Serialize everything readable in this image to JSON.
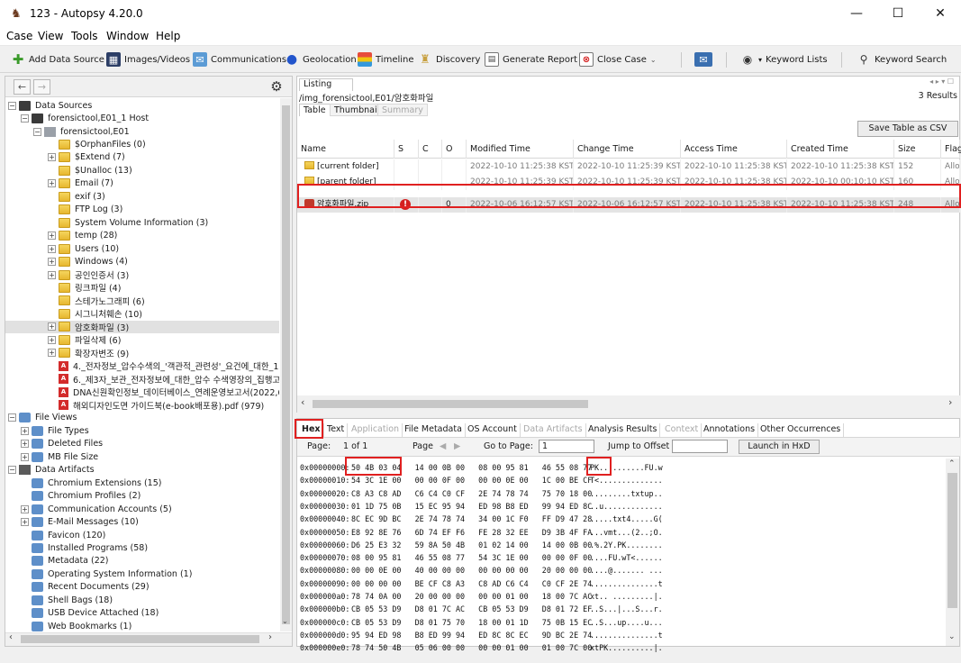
{
  "window": {
    "title": "123 - Autopsy 4.20.0",
    "controls": {
      "minimize": "—",
      "maximize": "☐",
      "close": "✕"
    }
  },
  "menu": [
    "Case",
    "View",
    "Tools",
    "Window",
    "Help"
  ],
  "toolbar": {
    "add_data_source": "Add Data Source",
    "images_videos": "Images/Videos",
    "communications": "Communications",
    "geolocation": "Geolocation",
    "timeline": "Timeline",
    "discovery": "Discovery",
    "generate_report": "Generate Report",
    "close_case": "Close Case",
    "keyword_lists": "Keyword Lists",
    "keyword_search": "Keyword Search"
  },
  "tree": [
    {
      "label": "Data Sources",
      "level": 0,
      "exp": "-",
      "icon": "drive"
    },
    {
      "label": "forensictool,E01_1 Host",
      "level": 1,
      "exp": "-",
      "icon": "drive"
    },
    {
      "label": "forensictool,E01",
      "level": 2,
      "exp": "-",
      "icon": "img"
    },
    {
      "label": "$OrphanFiles (0)",
      "level": 3,
      "exp": "",
      "icon": "folder"
    },
    {
      "label": "$Extend (7)",
      "level": 3,
      "exp": "+",
      "icon": "folder"
    },
    {
      "label": "$Unalloc (13)",
      "level": 3,
      "exp": "",
      "icon": "folder"
    },
    {
      "label": "Email (7)",
      "level": 3,
      "exp": "+",
      "icon": "folder"
    },
    {
      "label": "exif (3)",
      "level": 3,
      "exp": "",
      "icon": "folder"
    },
    {
      "label": "FTP Log (3)",
      "level": 3,
      "exp": "",
      "icon": "folder"
    },
    {
      "label": "System Volume Information (3)",
      "level": 3,
      "exp": "",
      "icon": "folder"
    },
    {
      "label": "temp (28)",
      "level": 3,
      "exp": "+",
      "icon": "folder"
    },
    {
      "label": "Users (10)",
      "level": 3,
      "exp": "+",
      "icon": "folder"
    },
    {
      "label": "Windows (4)",
      "level": 3,
      "exp": "+",
      "icon": "folder"
    },
    {
      "label": "공인인증서 (3)",
      "level": 3,
      "exp": "+",
      "icon": "folder"
    },
    {
      "label": "링크파일 (4)",
      "level": 3,
      "exp": "",
      "icon": "folder"
    },
    {
      "label": "스테가노그래피 (6)",
      "level": 3,
      "exp": "",
      "icon": "folder"
    },
    {
      "label": "시그니처훼손 (10)",
      "level": 3,
      "exp": "",
      "icon": "folder"
    },
    {
      "label": "암호화파일 (3)",
      "level": 3,
      "exp": "+",
      "icon": "folder",
      "selected": true
    },
    {
      "label": "파일삭제 (6)",
      "level": 3,
      "exp": "+",
      "icon": "folder"
    },
    {
      "label": "확장자변조 (9)",
      "level": 3,
      "exp": "+",
      "icon": "folder"
    },
    {
      "label": "4._전자정보_압수수색의_'객관적_관련성'_요건에_대한_1",
      "level": 3,
      "exp": "",
      "icon": "pdf"
    },
    {
      "label": "6._제3자_보관_전자정보에_대한_압수 수색영장의_집행고",
      "level": 3,
      "exp": "",
      "icon": "pdf"
    },
    {
      "label": "DNA신원확인정보_데이터베이스_연례운영보고서(2022,6",
      "level": 3,
      "exp": "",
      "icon": "pdf"
    },
    {
      "label": "해외디자인도면 가이드북(e-book배포용).pdf (979)",
      "level": 3,
      "exp": "",
      "icon": "pdf"
    },
    {
      "label": "File Views",
      "level": 0,
      "exp": "-",
      "icon": "generic"
    },
    {
      "label": "File Types",
      "level": 1,
      "exp": "+",
      "icon": "generic"
    },
    {
      "label": "Deleted Files",
      "level": 1,
      "exp": "+",
      "icon": "generic"
    },
    {
      "label": "MB File Size",
      "level": 1,
      "exp": "+",
      "icon": "generic"
    },
    {
      "label": "Data Artifacts",
      "level": 0,
      "exp": "-",
      "icon": "db"
    },
    {
      "label": "Chromium Extensions (15)",
      "level": 1,
      "exp": "",
      "icon": "generic"
    },
    {
      "label": "Chromium Profiles (2)",
      "level": 1,
      "exp": "",
      "icon": "generic"
    },
    {
      "label": "Communication Accounts (5)",
      "level": 1,
      "exp": "+",
      "icon": "generic"
    },
    {
      "label": "E-Mail Messages (10)",
      "level": 1,
      "exp": "+",
      "icon": "generic"
    },
    {
      "label": "Favicon (120)",
      "level": 1,
      "exp": "",
      "icon": "generic"
    },
    {
      "label": "Installed Programs (58)",
      "level": 1,
      "exp": "",
      "icon": "generic"
    },
    {
      "label": "Metadata (22)",
      "level": 1,
      "exp": "",
      "icon": "generic"
    },
    {
      "label": "Operating System Information (1)",
      "level": 1,
      "exp": "",
      "icon": "generic"
    },
    {
      "label": "Recent Documents (29)",
      "level": 1,
      "exp": "",
      "icon": "generic"
    },
    {
      "label": "Shell Bags (18)",
      "level": 1,
      "exp": "",
      "icon": "generic"
    },
    {
      "label": "USB Device Attached (18)",
      "level": 1,
      "exp": "",
      "icon": "generic"
    },
    {
      "label": "Web Bookmarks (1)",
      "level": 1,
      "exp": "",
      "icon": "generic"
    }
  ],
  "listing": {
    "tab_label": "Listing",
    "path": "/img_forensictool,E01/암호화파일",
    "result_count": "3 Results",
    "tabs": [
      "Table",
      "Thumbnail",
      "Summary"
    ],
    "save_csv": "Save Table as CSV",
    "columns": [
      "Name",
      "S",
      "C",
      "O",
      "Modified Time",
      "Change Time",
      "Access Time",
      "Created Time",
      "Size",
      "Flag"
    ],
    "rows": [
      {
        "name": "[current folder]",
        "s": "",
        "c": "",
        "o": "",
        "modified": "2022-10-10 11:25:38 KST",
        "change": "2022-10-10 11:25:39 KST",
        "access": "2022-10-10 11:25:38 KST",
        "created": "2022-10-10 11:25:38 KST",
        "size": "152",
        "flag": "Allo"
      },
      {
        "name": "[parent folder]",
        "s": "",
        "c": "",
        "o": "",
        "modified": "2022-10-10 11:25:39 KST",
        "change": "2022-10-10 11:25:39 KST",
        "access": "2022-10-10 11:25:38 KST",
        "created": "2022-10-10 00:10:10 KST",
        "size": "160",
        "flag": "Allo"
      },
      {
        "name": "암호화파일.zip",
        "s": "!",
        "c": "",
        "o": "0",
        "modified": "2022-10-06 16:12:57 KST",
        "change": "2022-10-06 16:12:57 KST",
        "access": "2022-10-10 11:25:38 KST",
        "created": "2022-10-10 11:25:38 KST",
        "size": "248",
        "flag": "Allo"
      }
    ]
  },
  "viewer": {
    "tabs": [
      "Hex",
      "Text",
      "Application",
      "File Metadata",
      "OS Account",
      "Data Artifacts",
      "Analysis Results",
      "Context",
      "Annotations",
      "Other Occurrences"
    ],
    "page_label": "Page:",
    "page_value": "1  of  1",
    "page_nav_label": "Page",
    "goto_label": "Go to Page:",
    "goto_value": "1",
    "jump_label": "Jump to Offset",
    "jump_value": "",
    "launch": "Launch in HxD",
    "hex_lines": [
      {
        "off": "0x00000000:",
        "hex": "50 4B 03 04   14 00 0B 00   08 00 95 81   46 55 08 77",
        "ascii": "PK..........FU.w"
      },
      {
        "off": "0x00000010:",
        "hex": "54 3C 1E 00   00 00 0F 00   00 00 0E 00   1C 00 BE CF",
        "ascii": "T<.............."
      },
      {
        "off": "0x00000020:",
        "hex": "C8 A3 C8 AD   C6 C4 C0 CF   2E 74 78 74   75 70 18 00",
        "ascii": ".........txtup.."
      },
      {
        "off": "0x00000030:",
        "hex": "01 1D 75 0B   15 EC 95 94   ED 98 B8 ED   99 94 ED 8C",
        "ascii": "..u............."
      },
      {
        "off": "0x00000040:",
        "hex": "8C EC 9D BC   2E 74 78 74   34 00 1C F0   FF D9 47 28",
        "ascii": ".....txt4.....G("
      },
      {
        "off": "0x00000050:",
        "hex": "E8 92 8E 76   6D 74 EF F6   FE 28 32 EE   D9 3B 4F FA",
        "ascii": "...vmt...(2..;O."
      },
      {
        "off": "0x00000060:",
        "hex": "D6 25 E3 32   59 8A 50 4B   01 02 14 00   14 00 0B 00",
        "ascii": ".%.2Y.PK........"
      },
      {
        "off": "0x00000070:",
        "hex": "08 00 95 81   46 55 08 77   54 3C 1E 00   00 00 0F 00",
        "ascii": "....FU.wT<......"
      },
      {
        "off": "0x00000080:",
        "hex": "00 00 0E 00   40 00 00 00   00 00 00 00   20 00 00 00",
        "ascii": "....@....... ..."
      },
      {
        "off": "0x00000090:",
        "hex": "00 00 00 00   BE CF C8 A3   C8 AD C6 C4   C0 CF 2E 74",
        "ascii": "...............t"
      },
      {
        "off": "0x000000a0:",
        "hex": "78 74 0A 00   20 00 00 00   00 00 01 00   18 00 7C AC",
        "ascii": "xt.. .........|."
      },
      {
        "off": "0x000000b0:",
        "hex": "CB 05 53 D9   D8 01 7C AC   CB 05 53 D9   D8 01 72 EF",
        "ascii": "..S...|...S...r."
      },
      {
        "off": "0x000000c0:",
        "hex": "CB 05 53 D9   D8 01 75 70   18 00 01 1D   75 0B 15 EC",
        "ascii": "..S...up....u..."
      },
      {
        "off": "0x000000d0:",
        "hex": "95 94 ED 98   B8 ED 99 94   ED 8C 8C EC   9D BC 2E 74",
        "ascii": "...............t"
      },
      {
        "off": "0x000000e0:",
        "hex": "78 74 50 4B   05 06 00 00   00 00 01 00   01 00 7C 00",
        "ascii": "xtPK..........|."
      }
    ]
  },
  "colors": {
    "highlight": "#e02020",
    "selected_row": "#e4e4e4",
    "warning": "#d41f1f"
  }
}
